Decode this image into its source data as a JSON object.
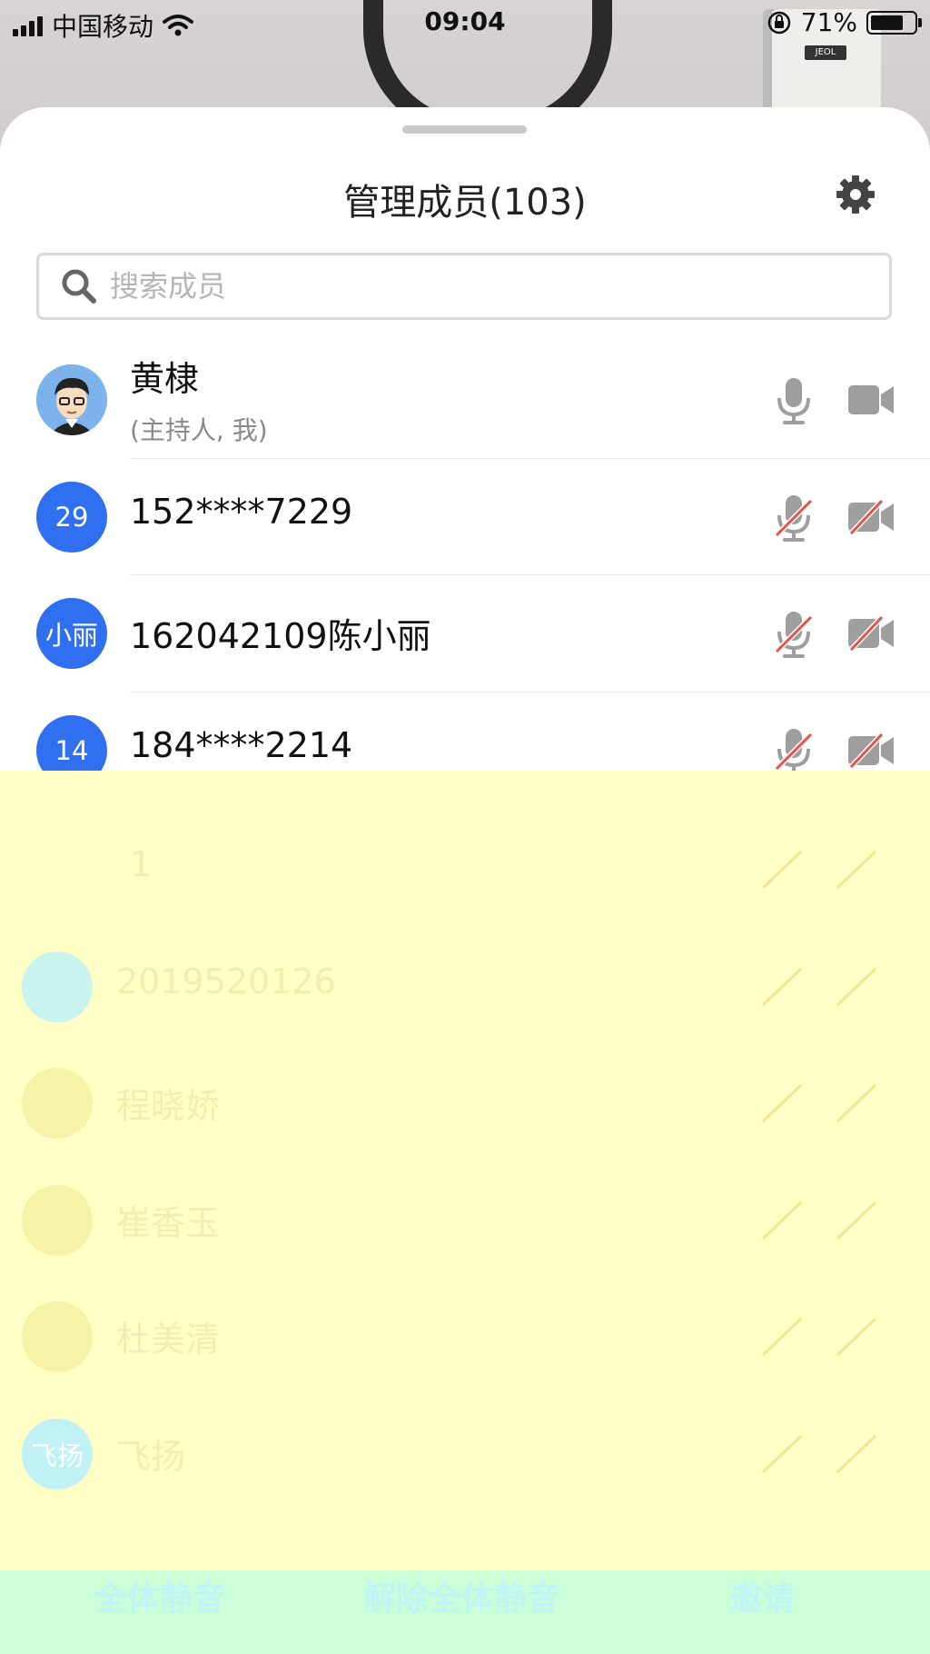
{
  "status_bar": {
    "carrier": "中国移动",
    "time": "09:04",
    "battery": "71%"
  },
  "sheet": {
    "title": "管理成员(103)",
    "search_placeholder": "搜索成员"
  },
  "members": [
    {
      "name": "黄棣",
      "role": "(主持人, 我)",
      "avatar_text": "",
      "mic": "on",
      "camera": "on"
    },
    {
      "name": "152****7229",
      "avatar_text": "29",
      "mic": "muted",
      "camera": "off"
    },
    {
      "name": "162042109陈小丽",
      "avatar_text": "小丽",
      "mic": "muted",
      "camera": "off"
    },
    {
      "name": "184****2214",
      "avatar_text": "14",
      "mic": "muted",
      "camera": "off"
    },
    {
      "name": "1",
      "avatar_text": ""
    },
    {
      "name": "2019520126",
      "avatar_text": ""
    },
    {
      "name": "程晓娇",
      "avatar_text": ""
    },
    {
      "name": "崔香玉",
      "avatar_text": ""
    },
    {
      "name": "杜美清",
      "avatar_text": ""
    },
    {
      "name": "飞扬",
      "avatar_text": "飞扬"
    }
  ],
  "actions": {
    "mute_all": "全体静音",
    "unmute_all": "解除全体静音",
    "invite": "邀请"
  },
  "colors": {
    "accent_blue": "#2f6ff0",
    "muted_red": "#e8504a",
    "overlay_yellow": "#ffffc6",
    "bottom_green": "#ccffd8"
  }
}
